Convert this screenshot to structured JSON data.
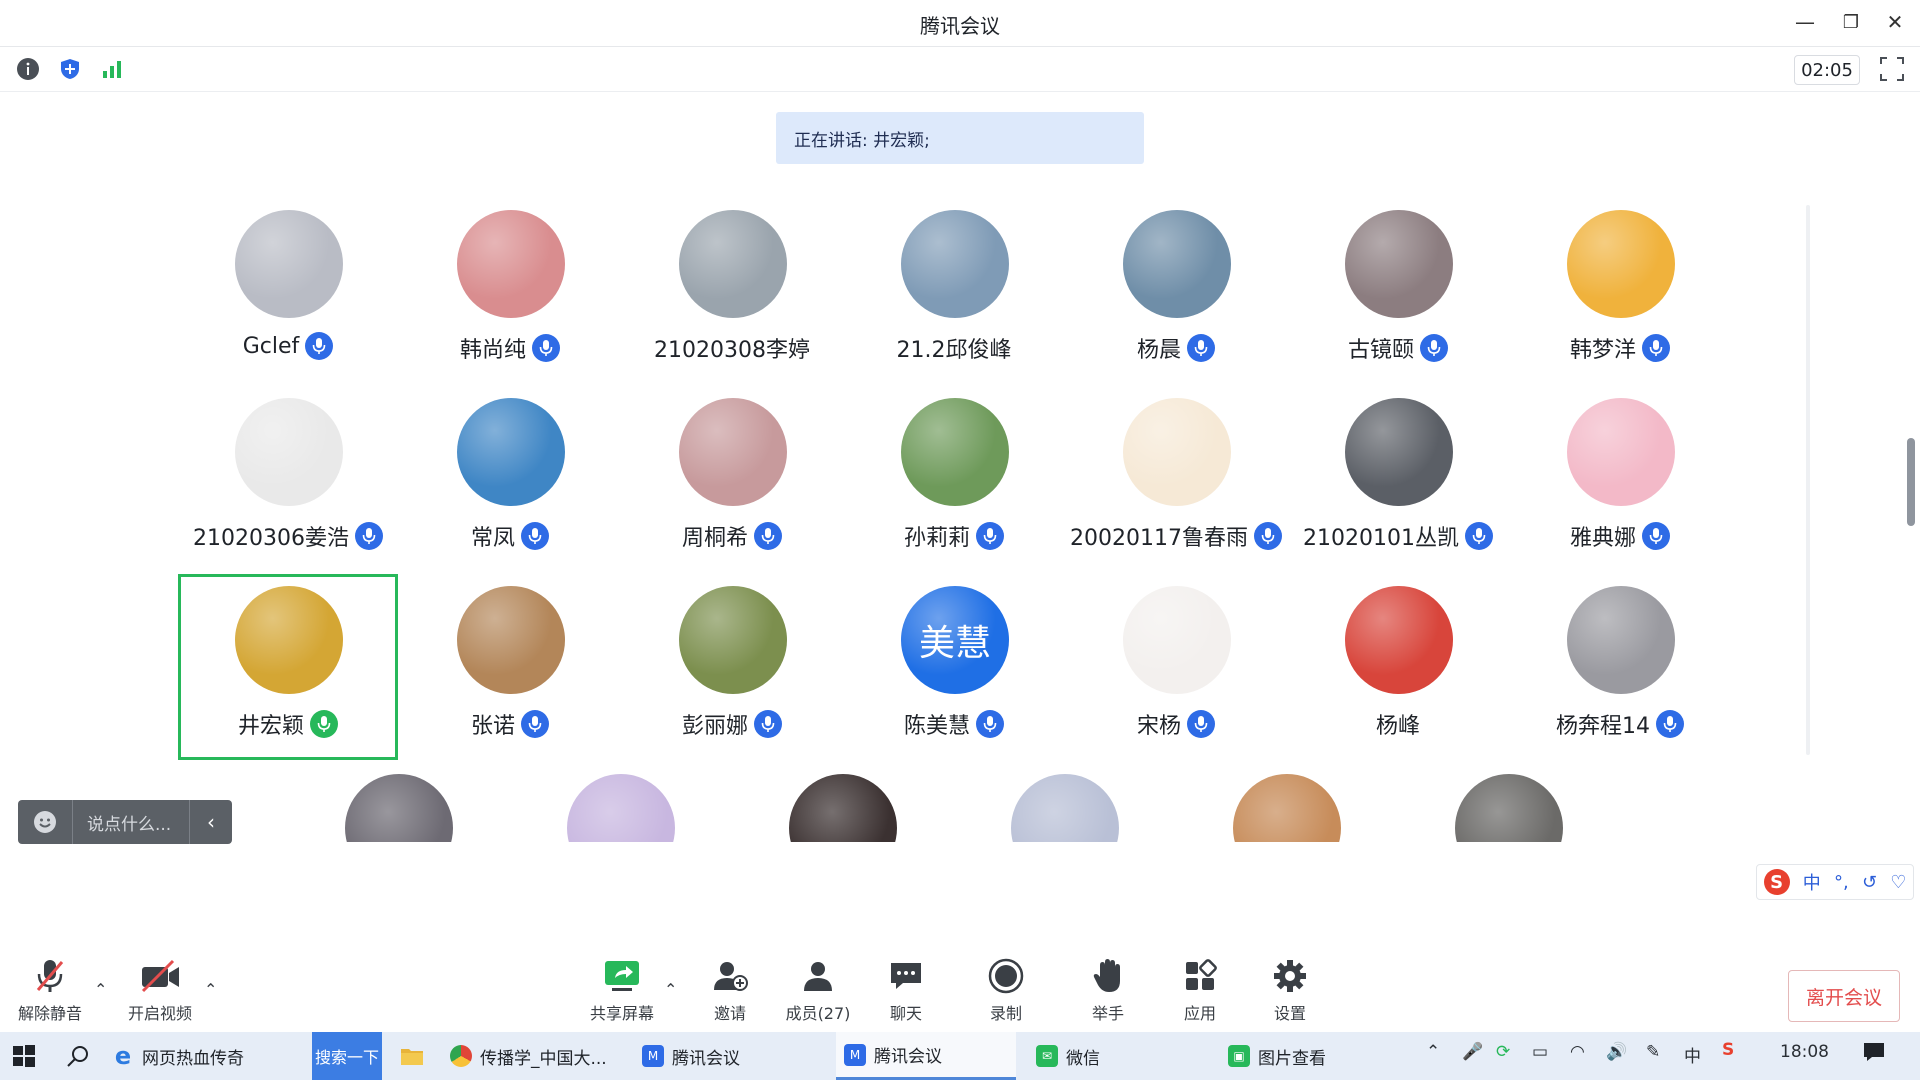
{
  "window": {
    "title": "腾讯会议",
    "minimize": "—",
    "restore": "❐",
    "close": "✕"
  },
  "infobar": {
    "timer": "02:05"
  },
  "speaking": {
    "text": "正在讲话: 井宏颖;"
  },
  "participants": [
    {
      "name": "Gclef",
      "mic": true,
      "avatar_color": "#b9bcc5"
    },
    {
      "name": "韩尚纯",
      "mic": true,
      "avatar_color": "#d98d8f"
    },
    {
      "name": "21020308李婷",
      "mic": false,
      "avatar_color": "#9aa4ad"
    },
    {
      "name": "21.2邱俊峰",
      "mic": false,
      "avatar_color": "#7f9bb6"
    },
    {
      "name": "杨晨",
      "mic": true,
      "avatar_color": "#6f8ea8"
    },
    {
      "name": "古镜颐",
      "mic": true,
      "avatar_color": "#8c7d80"
    },
    {
      "name": "韩梦洋",
      "mic": true,
      "avatar_color": "#f0b23c"
    },
    {
      "name": "21020306姜浩",
      "mic": true,
      "avatar_color": "#e9e9e9"
    },
    {
      "name": "常凤",
      "mic": true,
      "avatar_color": "#3f86c5"
    },
    {
      "name": "周桐希",
      "mic": true,
      "avatar_color": "#c79a9c"
    },
    {
      "name": "孙莉莉",
      "mic": true,
      "avatar_color": "#6e9a5a"
    },
    {
      "name": "20020117鲁春雨",
      "mic": true,
      "avatar_color": "#f6e9d6"
    },
    {
      "name": "21020101丛凯",
      "mic": true,
      "avatar_color": "#5b5f66"
    },
    {
      "name": "雅典娜",
      "mic": true,
      "avatar_color": "#f3b9c8"
    },
    {
      "name": "井宏颖",
      "mic": true,
      "speaking": true,
      "avatar_color": "#d4a634"
    },
    {
      "name": "张诺",
      "mic": true,
      "avatar_color": "#b38659"
    },
    {
      "name": "彭丽娜",
      "mic": true,
      "avatar_color": "#7c8f4e"
    },
    {
      "name": "陈美慧",
      "mic": true,
      "avatar_text": "美慧",
      "avatar_color": "#1f6fe5"
    },
    {
      "name": "宋杨",
      "mic": true,
      "avatar_color": "#f3f0ee"
    },
    {
      "name": "杨峰",
      "mic": false,
      "avatar_color": "#d8453b"
    },
    {
      "name": "杨奔程14",
      "mic": true,
      "avatar_color": "#9a9aa0"
    }
  ],
  "partial_row_colors": [
    "#6d6a73",
    "#c8b7e0",
    "#3b3131",
    "#b9c0d6",
    "#c78c5a",
    "#6b6a68"
  ],
  "chat": {
    "placeholder": "说点什么...",
    "toggle": "‹"
  },
  "ime": {
    "logo": "S",
    "items": [
      "中",
      "°,",
      "↺",
      "♡"
    ]
  },
  "toolbar": {
    "mute": "解除静音",
    "video": "开启视频",
    "share": "共享屏幕",
    "invite": "邀请",
    "members": "成员(27)",
    "chat": "聊天",
    "record": "录制",
    "raise": "举手",
    "apps": "应用",
    "settings": "设置",
    "leave": "离开会议"
  },
  "taskbar": {
    "browser": "网页热血传奇",
    "search": "搜索一下",
    "items": [
      "传播学_中国大...",
      "腾讯会议",
      "腾讯会议",
      "微信",
      "图片查看"
    ],
    "time": "18:08"
  }
}
